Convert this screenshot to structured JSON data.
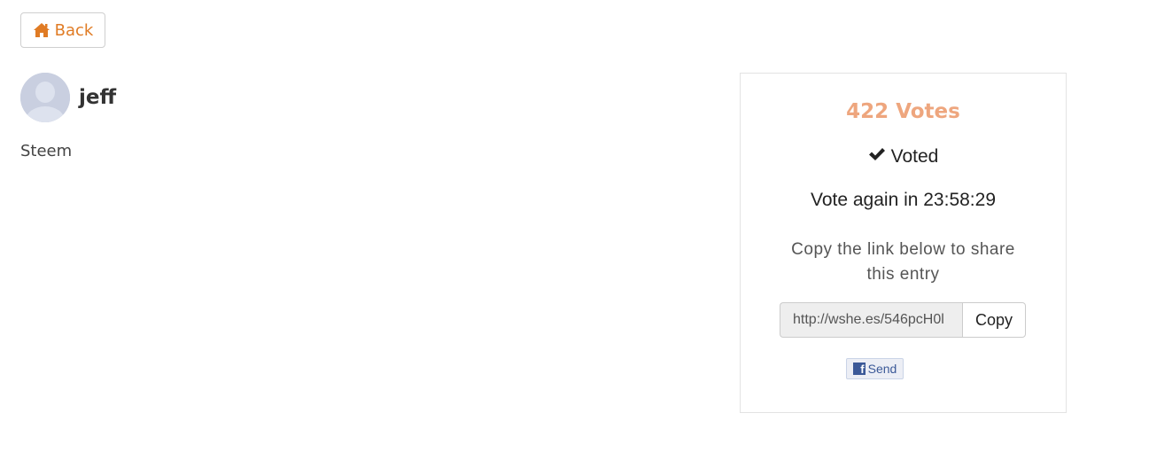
{
  "nav": {
    "back_label": "Back",
    "back_icon": "home-icon",
    "accent_color": "#e07b24"
  },
  "entry": {
    "username": "jeff",
    "category": "Steem",
    "avatar_icon": "default-user-avatar-icon"
  },
  "vote_card": {
    "votes_label": "422 Votes",
    "votes_color": "#eea67e",
    "voted_icon": "checkmark-icon",
    "voted_label": "Voted",
    "countdown_label": "Vote again in 23:58:29",
    "share_text": "Copy the link below to share this entry",
    "share_url": "http://wshe.es/546pcH0l",
    "copy_label": "Copy",
    "fb_send_label": "Send",
    "fb_icon": "facebook-icon",
    "fb_color": "#3b5998"
  }
}
